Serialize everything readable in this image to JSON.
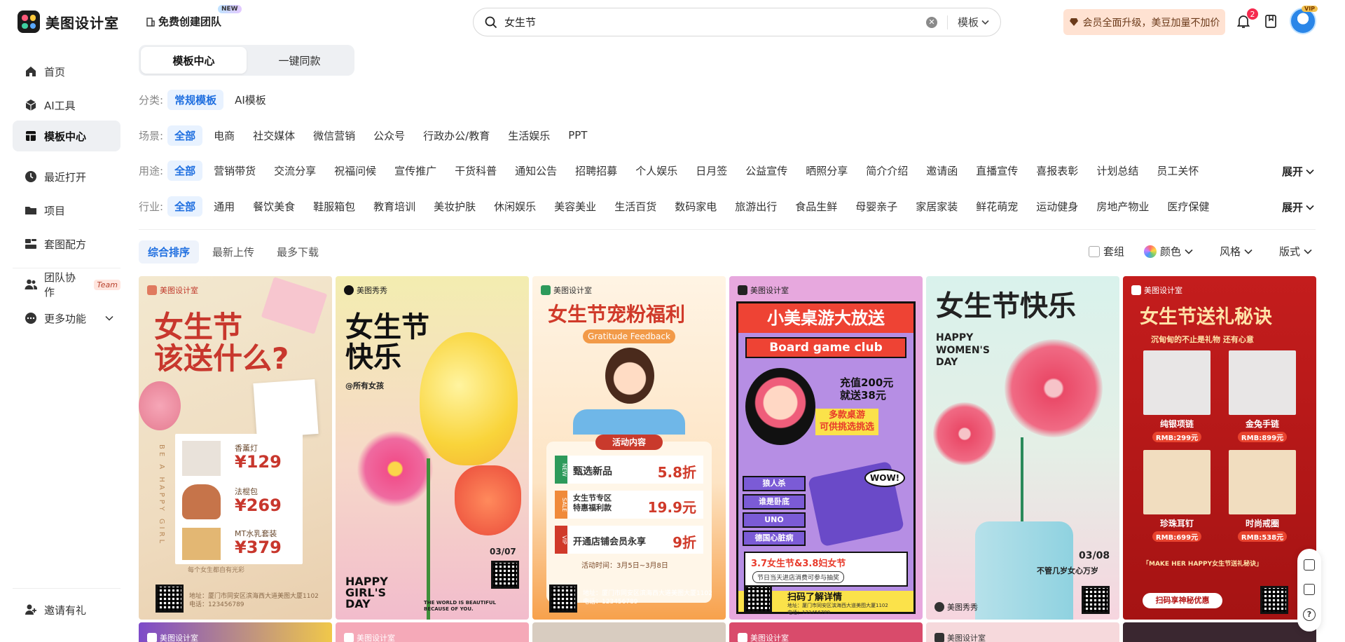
{
  "header": {
    "app_name": "美图设计室",
    "team_create": "免费创建团队",
    "new_badge": "NEW",
    "search_query": "女生节",
    "search_type": "模板",
    "vip_banner": "会员全面升级，美豆加量不加价",
    "notifications": "2",
    "vip_tag": "VIP"
  },
  "sidebar": {
    "items": [
      {
        "label": "首页",
        "icon": "home-icon"
      },
      {
        "label": "AI工具",
        "icon": "ai-tool-icon"
      },
      {
        "label": "模板中心",
        "icon": "template-icon"
      },
      {
        "label": "最近打开",
        "icon": "clock-icon"
      },
      {
        "label": "项目",
        "icon": "folder-icon"
      },
      {
        "label": "套图配方",
        "icon": "recipe-icon"
      },
      {
        "label": "团队协作",
        "icon": "team-icon"
      },
      {
        "label": "更多功能",
        "icon": "more-icon"
      }
    ],
    "team_tag": "Team",
    "invite": "邀请有礼"
  },
  "tabs": [
    "模板中心",
    "一键同款"
  ],
  "filters": {
    "category": {
      "label": "分类:",
      "items": [
        "常规模板",
        "AI模板"
      ]
    },
    "scene": {
      "label": "场景:",
      "items": [
        "全部",
        "电商",
        "社交媒体",
        "微信营销",
        "公众号",
        "行政办公/教育",
        "生活娱乐",
        "PPT"
      ]
    },
    "usage": {
      "label": "用途:",
      "items": [
        "全部",
        "营销带货",
        "交流分享",
        "祝福问候",
        "宣传推广",
        "干货科普",
        "通知公告",
        "招聘招募",
        "个人娱乐",
        "日月签",
        "公益宣传",
        "晒照分享",
        "简介介绍",
        "邀请函",
        "直播宣传",
        "喜报表彰",
        "计划总结",
        "员工关怀"
      ]
    },
    "industry": {
      "label": "行业:",
      "items": [
        "全部",
        "通用",
        "餐饮美食",
        "鞋服箱包",
        "教育培训",
        "美妆护肤",
        "休闲娱乐",
        "美容美业",
        "生活百货",
        "数码家电",
        "旅游出行",
        "食品生鲜",
        "母婴亲子",
        "家居家装",
        "鲜花萌宠",
        "运动健身",
        "房地产物业",
        "医疗保健"
      ]
    },
    "expand": "展开"
  },
  "sort": {
    "options": [
      "综合排序",
      "最新上传",
      "最多下载"
    ],
    "set_label": "套组",
    "color_label": "颜色",
    "style_label": "风格",
    "layout_label": "版式"
  },
  "cards": [
    {
      "brand": "美图设计室",
      "title": "女生节\n该送什么?",
      "items": [
        [
          "香薰灯",
          "¥129"
        ],
        [
          "法棍包",
          "¥269"
        ],
        [
          "MT水乳套装",
          "¥379"
        ]
      ],
      "foot": "每个女生都自有光彩",
      "addr": "地址：厦门市同安区滨海西大道美图大厦1102\n电话：123456789",
      "side": "BE A HAPPY GIRL"
    },
    {
      "brand": "美图秀秀",
      "title": "女生节\n快乐",
      "sub": "@所有女孩",
      "date": "03/07",
      "bottom": "HAPPY\nGIRL'S\nDAY",
      "note": "THE WORLD IS BEAUTIFUL\nBECAUSE OF YOU."
    },
    {
      "brand": "美图设计室",
      "title": "女生节宠粉福利",
      "ribbon": "Gratitude Feedback",
      "section": "活动内容",
      "rows": [
        [
          "NEW",
          "甄选新品",
          "5.8折"
        ],
        [
          "SALE",
          "女生节专区\n特惠福利款",
          "19.9元"
        ],
        [
          "VIP",
          "开通店铺会员永享",
          "9折"
        ]
      ],
      "time": "活动时间：3月5日~3月8日",
      "addr": "地址：厦门市同安区滨海西大道美图大厦1102\n电话：123456789"
    },
    {
      "brand": "美图设计室",
      "title": "小美桌游大放送",
      "band": "Board game club",
      "promo": "充值200元\n就送38元",
      "tag": "多款桌游\n可供挑选挑选",
      "games": [
        "狼人杀",
        "谁是卧底",
        "UNO",
        "德国心脏病"
      ],
      "wow": "WOW!",
      "fest": "3.7女生节&3.8妇女节",
      "fest_sub": "节日当天进店消费可参与抽奖",
      "scan": "扫码了解详情",
      "addr": "地址：厦门市同安区滨海西大道美图大厦1102\n电话：123456789"
    },
    {
      "title": "女生节快乐",
      "en": "HAPPY\nWOMEN'S\nDAY",
      "date": "03/08",
      "slogan": "不管几岁女心万岁",
      "brand": "美图秀秀"
    },
    {
      "brand": "美图设计室",
      "title": "女生节送礼秘诀",
      "sub": "沉甸甸的不止是礼物 还有心意",
      "gifts": [
        [
          "纯银项链",
          "RMB:299元"
        ],
        [
          "金兔手链",
          "RMB:899元"
        ],
        [
          "珍珠耳钉",
          "RMB:699元"
        ],
        [
          "时尚戒圈",
          "RMB:538元"
        ]
      ],
      "make": "「MAKE HER HAPPY女生节送礼秘诀」",
      "btn": "扫码享神秘优惠"
    }
  ],
  "second_row": [
    "美图设计室",
    "美图设计室",
    "",
    "美图设计室",
    "美图设计室",
    ""
  ],
  "colors": {
    "accent": "#1f6fe0",
    "active_bg": "#e8f2ff"
  }
}
